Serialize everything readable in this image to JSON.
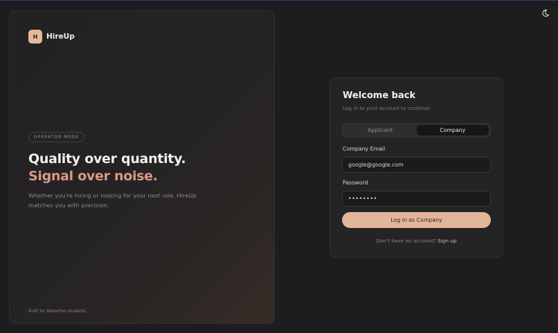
{
  "header": {
    "theme_toggle_icon": "moon-icon"
  },
  "hero": {
    "brand": {
      "mark_letter": "H",
      "name": "HireUp"
    },
    "mode_label": "OPERATOR MODE",
    "headline_line1": "Quality over quantity.",
    "headline_line2": "Signal over noise.",
    "description": "Whether you're hiring or looking for your next role, HireUp matches you with precision.",
    "footer": "Built by Waterloo students."
  },
  "login": {
    "title": "Welcome back",
    "subtitle": "Log in to your account to continue.",
    "tabs": [
      {
        "label": "Applicant",
        "active": false
      },
      {
        "label": "Company",
        "active": true
      }
    ],
    "email_label": "Company Email",
    "email_value": "google@google.com",
    "password_label": "Password",
    "password_value": "••••••••",
    "submit_label": "Log in as Company",
    "signup_prompt": "Don't have an account?",
    "signup_link": "Sign up"
  },
  "colors": {
    "accent": "#e3b59b",
    "headline_accent": "#d99a86",
    "background": "#1d1d1f",
    "card": "#242426"
  }
}
